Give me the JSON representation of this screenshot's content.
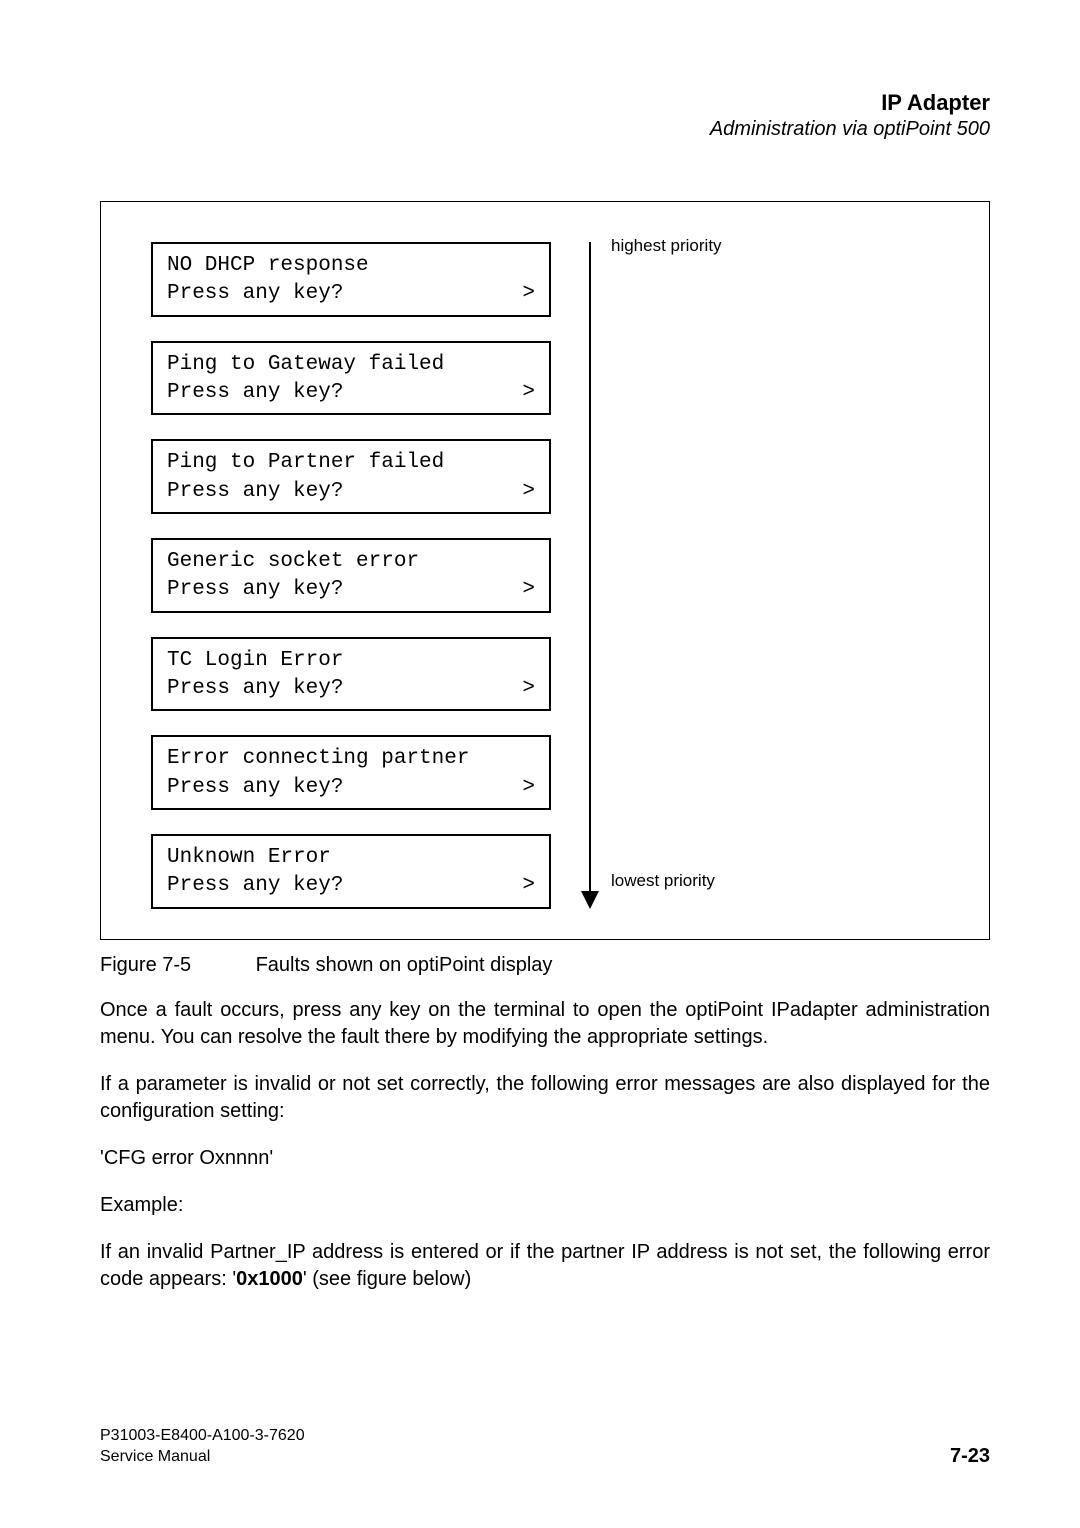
{
  "header": {
    "title": "IP Adapter",
    "subtitle": "Administration via optiPoint 500"
  },
  "figure": {
    "displays": [
      {
        "line1": "NO DHCP response",
        "line2": "Press any key?",
        "marker": ">"
      },
      {
        "line1": "Ping to Gateway failed",
        "line2": "Press any key?",
        "marker": ">"
      },
      {
        "line1": "Ping to Partner failed",
        "line2": "Press any key?",
        "marker": ">"
      },
      {
        "line1": "Generic socket error",
        "line2": "Press any key?",
        "marker": ">"
      },
      {
        "line1": "TC Login Error",
        "line2": "Press any key?",
        "marker": ">"
      },
      {
        "line1": "Error connecting partner",
        "line2": "Press any key?",
        "marker": ">"
      },
      {
        "line1": "Unknown Error",
        "line2": "Press any key?",
        "marker": ">"
      }
    ],
    "priority_top": "highest priority",
    "priority_bottom": "lowest priority",
    "caption_label": "Figure 7-5",
    "caption_text": "Faults shown on optiPoint display"
  },
  "body": {
    "p1": "Once a fault occurs, press any key on the terminal to open the optiPoint IPadapter administration menu. You can resolve the fault there by modifying the appropriate settings.",
    "p2": "If a parameter is invalid or not set correctly, the following error messages are also displayed for the configuration setting:",
    "p3": "'CFG error Oxnnnn'",
    "p4": "Example:",
    "p5_pre": "If an invalid Partner_IP address is entered or if the partner IP address is not set, the following error code appears: '",
    "p5_code": "0x1000",
    "p5_post": "' (see figure below)"
  },
  "footer": {
    "doc_id": "P31003-E8400-A100-3-7620",
    "doc_type": "Service Manual",
    "page": "7-23"
  }
}
